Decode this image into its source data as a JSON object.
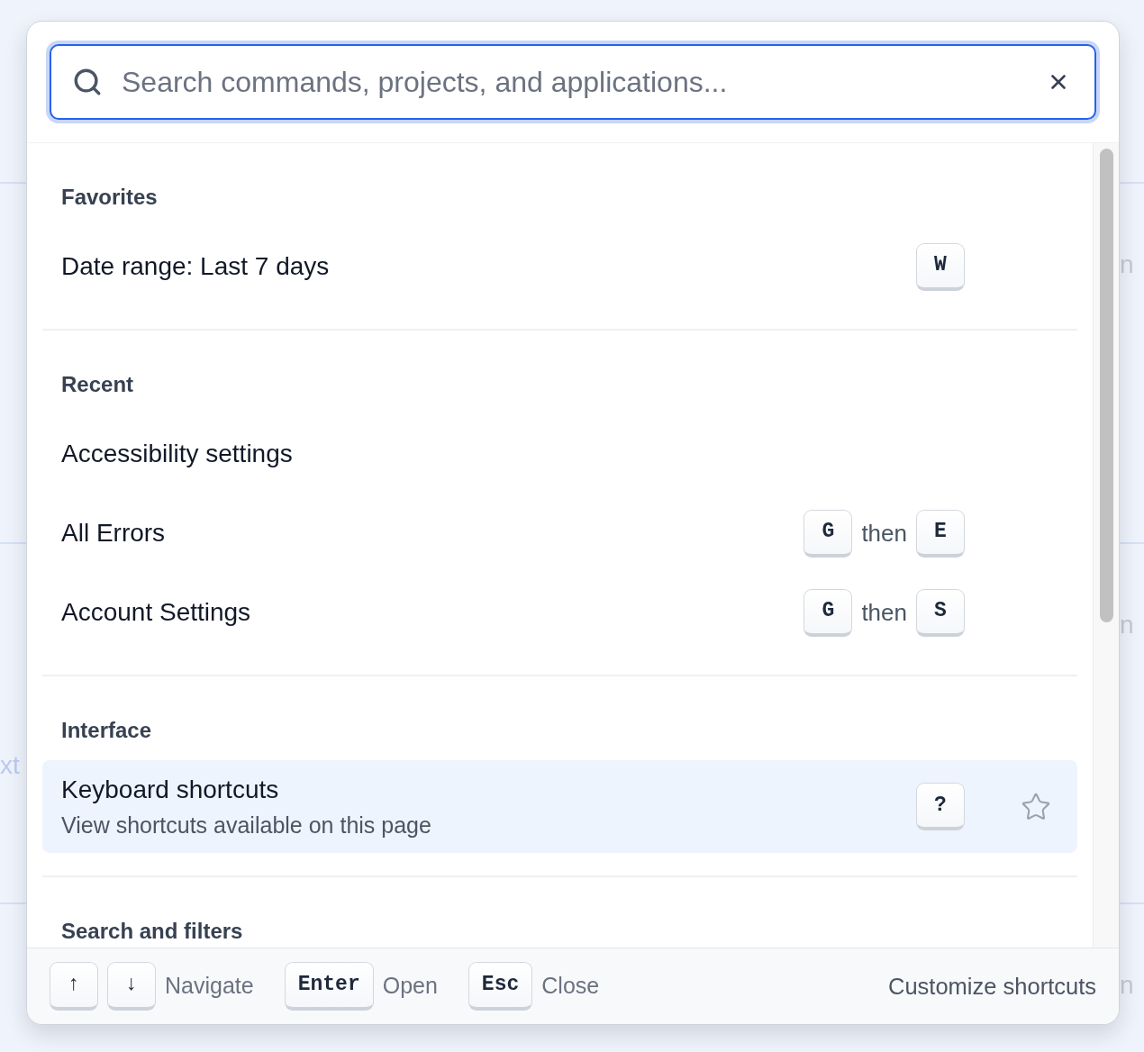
{
  "background_page": {
    "bands": [
      {
        "right": "n"
      },
      {
        "left": "xt",
        "right": "n"
      },
      {
        "right": "n"
      }
    ]
  },
  "search": {
    "placeholder": "Search commands, projects, and applications..."
  },
  "sections": [
    {
      "title": "Favorites",
      "items": [
        {
          "label": "Date range: Last 7 days",
          "selected": false,
          "shortcut": [
            {
              "kind": "key",
              "text": "W"
            }
          ]
        }
      ]
    },
    {
      "title": "Recent",
      "items": [
        {
          "label": "Accessibility settings",
          "selected": false
        },
        {
          "label": "All Errors",
          "selected": false,
          "shortcut": [
            {
              "kind": "key",
              "text": "G"
            },
            {
              "kind": "word",
              "text": "then"
            },
            {
              "kind": "key",
              "text": "E"
            }
          ]
        },
        {
          "label": "Account Settings",
          "selected": false,
          "shortcut": [
            {
              "kind": "key",
              "text": "G"
            },
            {
              "kind": "word",
              "text": "then"
            },
            {
              "kind": "key",
              "text": "S"
            }
          ]
        }
      ]
    },
    {
      "title": "Interface",
      "items": [
        {
          "label": "Keyboard shortcuts",
          "description": "View shortcuts available on this page",
          "selected": true,
          "starred": false,
          "shortcut": [
            {
              "kind": "key",
              "text": "?"
            }
          ]
        }
      ]
    },
    {
      "title": "Search and filters"
    }
  ],
  "footer": {
    "hints": [
      {
        "keys": [
          "↑",
          "↓"
        ],
        "label": "Navigate"
      },
      {
        "keys": [
          "Enter"
        ],
        "label": "Open"
      },
      {
        "keys": [
          "Esc"
        ],
        "label": "Close"
      }
    ],
    "link": "Customize shortcuts"
  }
}
